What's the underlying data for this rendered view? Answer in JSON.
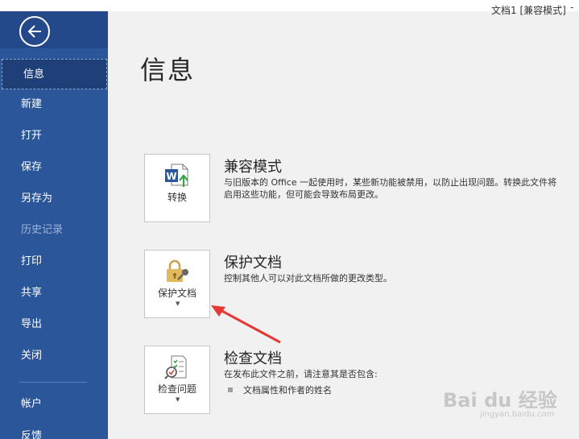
{
  "window": {
    "title": "文档1 [兼容模式]",
    "dash": "-"
  },
  "sidebar": {
    "items": [
      {
        "label": "信息"
      },
      {
        "label": "新建"
      },
      {
        "label": "打开"
      },
      {
        "label": "保存"
      },
      {
        "label": "另存为"
      },
      {
        "label": "历史记录"
      },
      {
        "label": "打印"
      },
      {
        "label": "共享"
      },
      {
        "label": "导出"
      },
      {
        "label": "关闭"
      },
      {
        "label": "帐户"
      },
      {
        "label": "反馈"
      }
    ]
  },
  "main": {
    "title": "信息",
    "sections": [
      {
        "tile_label": "转换",
        "heading": "兼容模式",
        "desc1": "与旧版本的 Office 一起使用时，某些新功能被禁用，以防止出现问题。转换此文件将",
        "desc2": "启用这些功能，但可能会导致布局更改。"
      },
      {
        "tile_label": "保护文档",
        "heading": "保护文档",
        "desc1": "控制其他人可以对此文档所做的更改类型。"
      },
      {
        "tile_label": "检查问题",
        "heading": "检查文档",
        "desc1": "在发布此文件之前，请注意其是否包含:",
        "bullet1": "文档属性和作者的姓名"
      }
    ]
  },
  "watermark": {
    "text": "Bai du 经验",
    "sub": "jingyan.baidu.com"
  }
}
